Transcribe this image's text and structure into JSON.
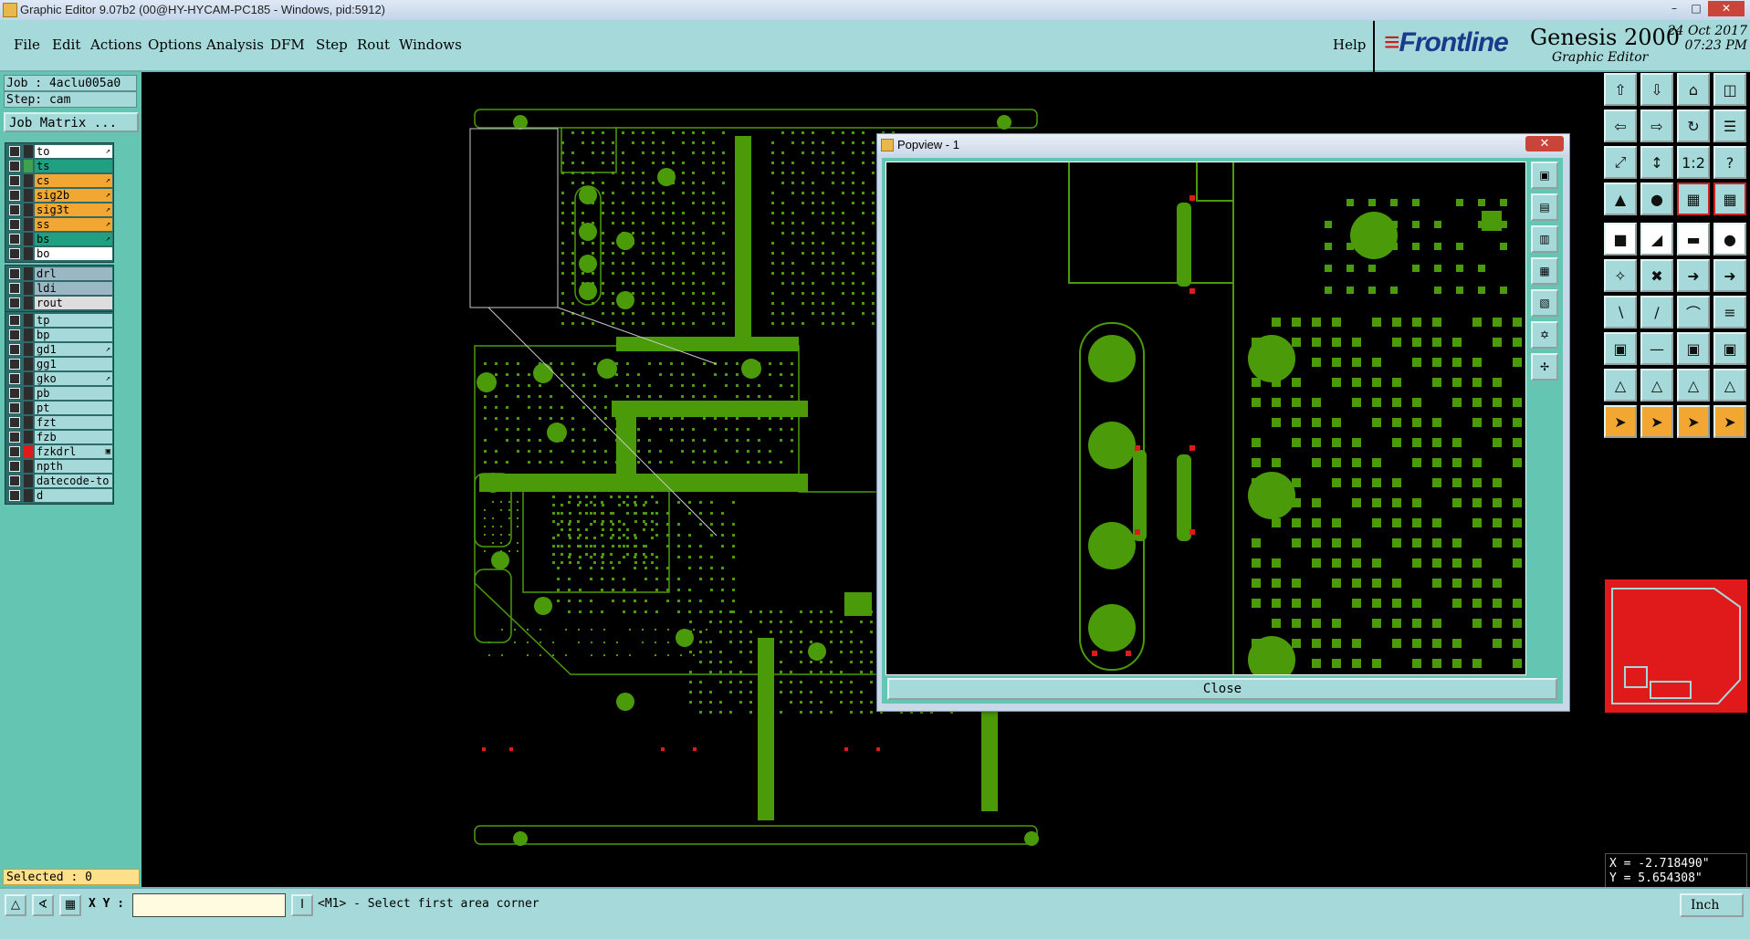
{
  "window": {
    "title": "Graphic Editor 9.07b2 (00@HY-HYCAM-PC185 - Windows, pid:5912)",
    "minimize": "–",
    "maximize": "□",
    "close": "✕"
  },
  "menu": {
    "file": "File",
    "edit": "Edit",
    "actions": "Actions",
    "options": "Options",
    "analysis": "Analysis",
    "dfm": "DFM",
    "step": "Step",
    "rout": "Rout",
    "windows": "Windows",
    "help": "Help"
  },
  "brand": {
    "frontline": "Frontline",
    "product": "Genesis 2000",
    "subtitle": "Graphic Editor",
    "date": "24 Oct 2017",
    "time": "07:23 PM"
  },
  "job": {
    "job_label": "Job : 4aclu005a0",
    "step_label": "Step: cam",
    "matrix_button": "Job Matrix ..."
  },
  "layers": {
    "group1": [
      {
        "name": "to",
        "bg": "#ffffff",
        "swatch": "#2d2d2d",
        "mark": "↗"
      },
      {
        "name": "ts",
        "bg": "#20a080",
        "swatch": "#3fa050",
        "mark": ""
      },
      {
        "name": "cs",
        "bg": "#f3a733",
        "swatch": "#2d2d2d",
        "mark": "↗"
      },
      {
        "name": "sig2b",
        "bg": "#f3a733",
        "swatch": "#2d2d2d",
        "mark": "↗"
      },
      {
        "name": "sig3t",
        "bg": "#f3a733",
        "swatch": "#2d2d2d",
        "mark": "↗"
      },
      {
        "name": "ss",
        "bg": "#f3a733",
        "swatch": "#2d2d2d",
        "mark": "↗"
      },
      {
        "name": "bs",
        "bg": "#20a080",
        "swatch": "#2d2d2d",
        "mark": "↗"
      },
      {
        "name": "bo",
        "bg": "#ffffff",
        "swatch": "#2d2d2d",
        "mark": ""
      }
    ],
    "group2": [
      {
        "name": "drl",
        "bg": "#9ab8c4",
        "swatch": "#2d2d2d",
        "mark": ""
      },
      {
        "name": "ldi",
        "bg": "#9ab8c4",
        "swatch": "#2d2d2d",
        "mark": ""
      },
      {
        "name": "rout",
        "bg": "#dddddd",
        "swatch": "#2d2d2d",
        "mark": ""
      }
    ],
    "group3": [
      {
        "name": "tp",
        "bg": "#a6dada",
        "swatch": "#2d2d2d",
        "mark": ""
      },
      {
        "name": "bp",
        "bg": "#a6dada",
        "swatch": "#2d2d2d",
        "mark": ""
      },
      {
        "name": "gd1",
        "bg": "#a6dada",
        "swatch": "#2d2d2d",
        "mark": "↗"
      },
      {
        "name": "gg1",
        "bg": "#a6dada",
        "swatch": "#2d2d2d",
        "mark": ""
      },
      {
        "name": "gko",
        "bg": "#a6dada",
        "swatch": "#2d2d2d",
        "mark": "↗"
      },
      {
        "name": "pb",
        "bg": "#a6dada",
        "swatch": "#2d2d2d",
        "mark": ""
      },
      {
        "name": "pt",
        "bg": "#a6dada",
        "swatch": "#2d2d2d",
        "mark": ""
      },
      {
        "name": "fzt",
        "bg": "#a6dada",
        "swatch": "#2d2d2d",
        "mark": ""
      },
      {
        "name": "fzb",
        "bg": "#a6dada",
        "swatch": "#2d2d2d",
        "mark": ""
      },
      {
        "name": "fzkdrl",
        "bg": "#a6dada",
        "swatch": "#e01a1a",
        "mark": "▣"
      },
      {
        "name": "npth",
        "bg": "#a6dada",
        "swatch": "#2d2d2d",
        "mark": ""
      },
      {
        "name": "datecode-to",
        "bg": "#a6dada",
        "swatch": "#2d2d2d",
        "mark": ""
      },
      {
        "name": "d",
        "bg": "#a6dada",
        "swatch": "#2d2d2d",
        "mark": ""
      }
    ]
  },
  "selected": "Selected : 0",
  "popview": {
    "title": "Popview - 1",
    "close_label": "Close"
  },
  "coords": {
    "x": "X = -2.718490\"",
    "y": "Y = 5.654308\""
  },
  "status": {
    "xy_label": "X Y :",
    "xy_value": "",
    "prompt": "<M1> - Select first area corner",
    "units": "Inch"
  },
  "colors": {
    "copper": "#4a9a0a",
    "pad_red": "#e01a1a",
    "panel_teal": "#a6dada",
    "active_orange": "#f3a733"
  }
}
